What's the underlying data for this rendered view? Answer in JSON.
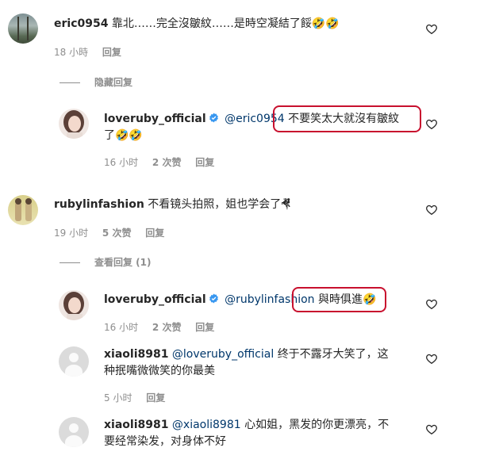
{
  "comments": [
    {
      "username": "eric0954",
      "text": "靠北……完全沒皺紋……是時空凝結了餒🤣🤣",
      "time": "18 小時",
      "reply": "回复"
    },
    {
      "toggle": "隐藏回复"
    },
    {
      "username": "loveruby_official",
      "mention": "@eric0954",
      "text_line1": "不要笑太大就沒有皺紋",
      "text_line2": "了🤣🤣",
      "time": "16 小时",
      "likes": "2 次赞",
      "reply": "回复"
    },
    {
      "username": "rubylinfashion",
      "text": "不看镜头拍照，姐也学会了🤻",
      "time": "19 小时",
      "likes": "5 次赞",
      "reply": "回复"
    },
    {
      "toggle": "查看回复 (1)"
    },
    {
      "username": "loveruby_official",
      "mention": "@rubylinfashion",
      "text": "與時俱進🤣",
      "time": "16 小时",
      "likes": "2 次赞",
      "reply": "回复"
    },
    {
      "username": "xiaoli8981",
      "mention": "@loveruby_official",
      "text_line1": "终于不露牙大笑了，这",
      "text_line2": "种抿嘴微微笑的你最美",
      "time": "5 小时",
      "reply": "回复"
    },
    {
      "username": "xiaoli8981",
      "mention": "@xiaoli8981",
      "text_line1": "心如姐，黑发的你更漂亮，不",
      "text_line2": "要经常染发，对身体不好"
    }
  ],
  "colors": {
    "highlight_oval": "#c8102e",
    "verified_badge": "#3897f0",
    "mention": "#00376b",
    "meta": "#8e8e8e"
  }
}
